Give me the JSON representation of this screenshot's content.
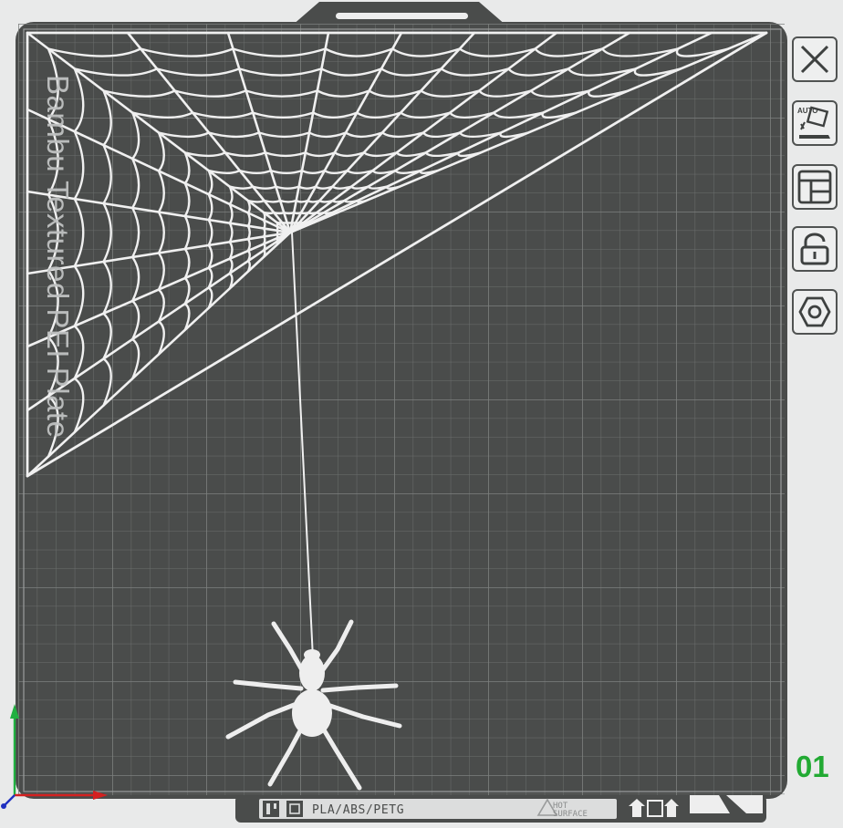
{
  "plate": {
    "name": "Bambu Textured PEI Plate",
    "number": "01",
    "bottom_strip": {
      "materials": "PLA/ABS/PETG",
      "warning_line1": "HOT",
      "warning_line2": "SURFACE"
    }
  },
  "toolbar": {
    "buttons": [
      {
        "id": "close",
        "icon": "close-icon"
      },
      {
        "id": "auto-arrange",
        "icon": "auto-orient-icon",
        "badge": "AUTO"
      },
      {
        "id": "arrange",
        "icon": "layout-icon"
      },
      {
        "id": "lock",
        "icon": "lock-icon"
      },
      {
        "id": "settings",
        "icon": "hex-nut-icon"
      }
    ]
  },
  "colors": {
    "plate": "#4a4c4b",
    "grid": "#6a6d6c",
    "web": "#f2f2f2",
    "axis_x": "#d42020",
    "axis_y": "#20b040",
    "plate_number": "#22aa33"
  }
}
